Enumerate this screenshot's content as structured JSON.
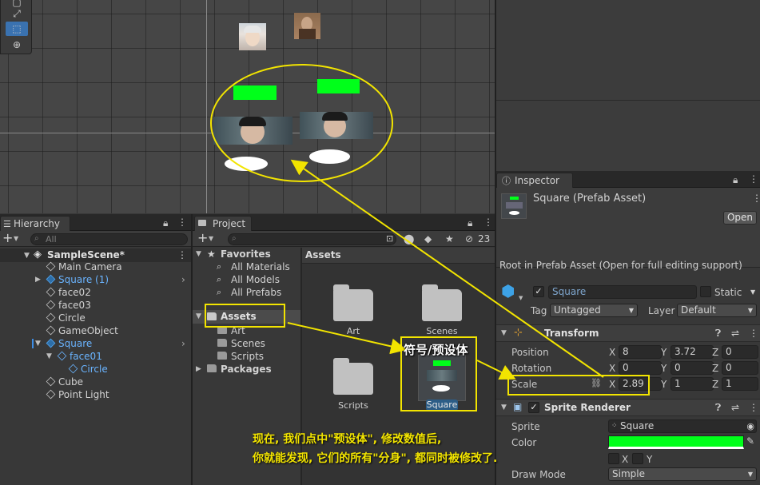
{
  "scene_tools": {
    "icons": [
      "rect-select-icon",
      "rect-transform-icon",
      "transform-icon"
    ]
  },
  "hierarchy": {
    "tab_label": "Hierarchy",
    "add_label": "+",
    "search_placeholder": "All",
    "scene_name": "SampleScene*",
    "items": [
      "Main Camera",
      "Square (1)",
      "face02",
      "face03",
      "Circle",
      "GameObject",
      "Square",
      "face01",
      "Circle",
      "Cube",
      "Point Light"
    ]
  },
  "project": {
    "tab_label": "Project",
    "add_label": "+",
    "hidden_count": "23",
    "favorites_label": "Favorites",
    "favorites": [
      "All Materials",
      "All Models",
      "All Prefabs"
    ],
    "assets_label": "Assets",
    "asset_children": [
      "Art",
      "Scenes",
      "Scripts"
    ],
    "packages_label": "Packages",
    "content_title": "Assets",
    "grid_items": [
      "Art",
      "Scenes",
      "Scripts",
      "Square"
    ]
  },
  "inspector": {
    "tab_label": "Inspector",
    "object_title": "Square (Prefab Asset)",
    "open_button": "Open",
    "root_note": "Root in Prefab Asset (Open for full editing support)",
    "name_value": "Square",
    "static_label": "Static",
    "tag_label": "Tag",
    "tag_value": "Untagged",
    "layer_label": "Layer",
    "layer_value": "Default",
    "transform": {
      "title": "Transform",
      "position_label": "Position",
      "position": {
        "x": "8",
        "y": "3.72",
        "z": "0"
      },
      "rotation_label": "Rotation",
      "rotation": {
        "x": "0",
        "y": "0",
        "z": "0"
      },
      "scale_label": "Scale",
      "scale": {
        "x": "2.89",
        "y": "1",
        "z": "1"
      }
    },
    "sprite_renderer": {
      "title": "Sprite Renderer",
      "sprite_label": "Sprite",
      "sprite_value": "Square",
      "color_label": "Color",
      "color_value": "#00ff1a",
      "flip_label": "",
      "flip_x": "X",
      "flip_y": "Y",
      "draw_mode_label": "Draw Mode",
      "draw_mode_value": "Simple"
    }
  },
  "annotations": {
    "prefab_label": "符号/预设体",
    "line1": "现在, 我们点中\"预设体\", 修改数值后,",
    "line2": "你就能发现, 它们的所有\"分身\", 都同时被修改了.",
    "annotation_color": "#f2e400"
  },
  "axes_labels": {
    "x": "X",
    "y": "Y",
    "z": "Z"
  }
}
